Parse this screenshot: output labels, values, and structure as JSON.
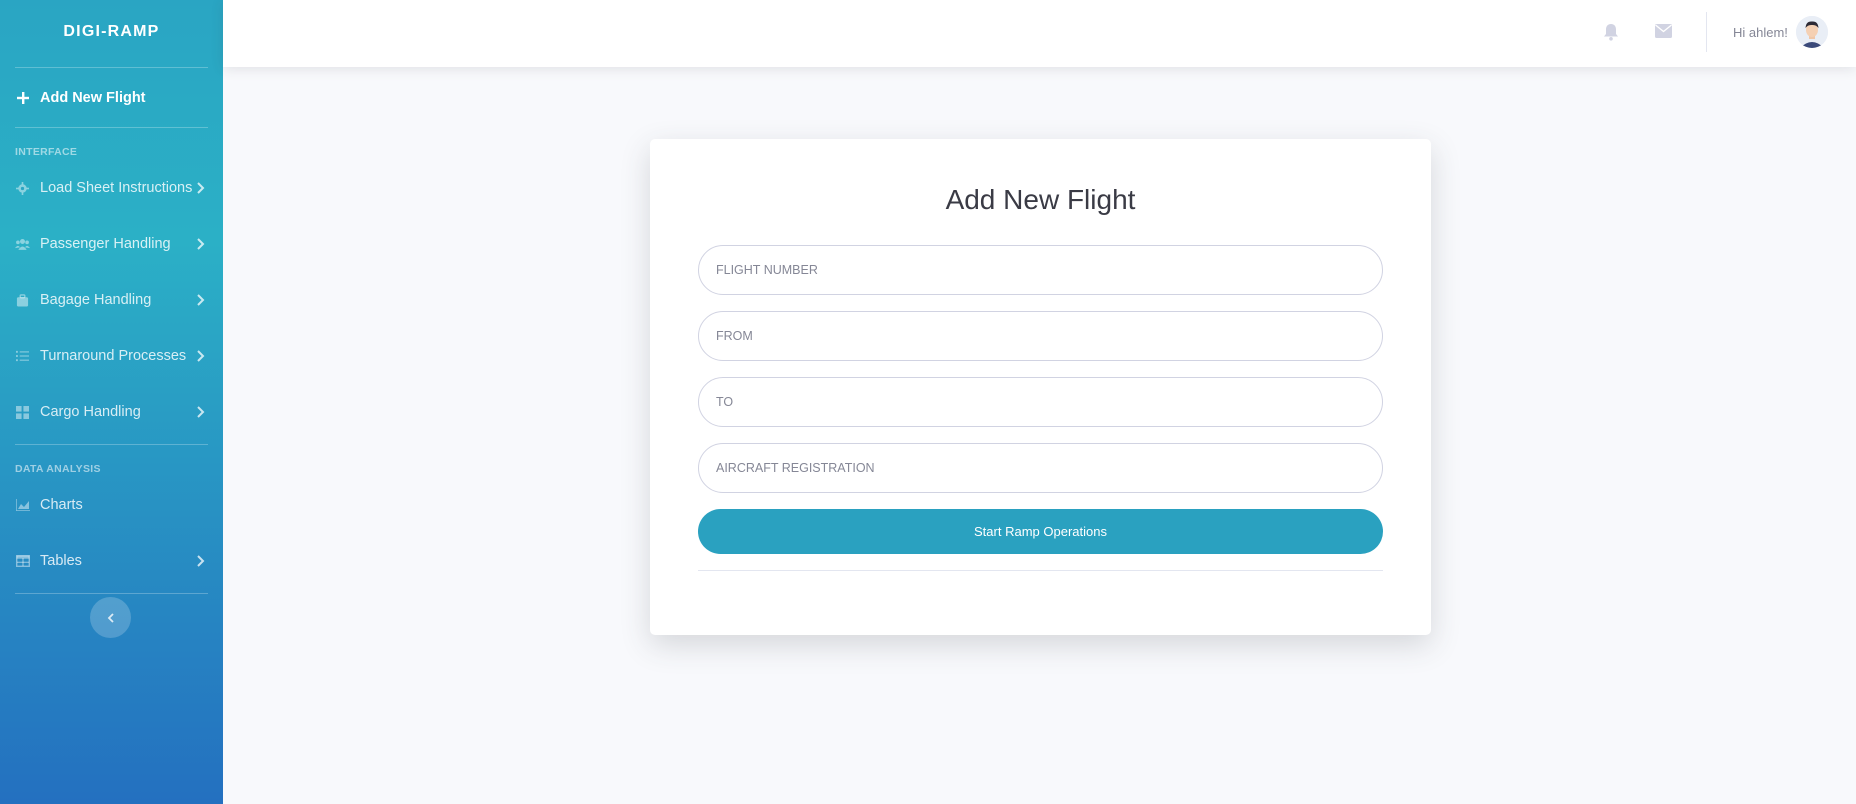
{
  "brand": "DIGI-RAMP",
  "sidebar": {
    "primary_action": {
      "label": "Add New Flight",
      "icon": "plus-icon"
    },
    "sections": [
      {
        "heading": "INTERFACE",
        "items": [
          {
            "label": "Load Sheet Instructions",
            "icon": "cog-icon",
            "has_chevron": true
          },
          {
            "label": "Passenger Handling",
            "icon": "users-icon",
            "has_chevron": true
          },
          {
            "label": "Bagage Handling",
            "icon": "suitcase-icon",
            "has_chevron": true
          },
          {
            "label": "Turnaround Processes",
            "icon": "list-icon",
            "has_chevron": true
          },
          {
            "label": "Cargo Handling",
            "icon": "grid-icon",
            "has_chevron": true
          }
        ]
      },
      {
        "heading": "DATA ANALYSIS",
        "items": [
          {
            "label": "Charts",
            "icon": "chart-area-icon",
            "has_chevron": false
          },
          {
            "label": "Tables",
            "icon": "table-icon",
            "has_chevron": true
          }
        ]
      }
    ],
    "toggle_icon": "chevron-left-icon"
  },
  "topbar": {
    "alerts_icon": "bell-icon",
    "messages_icon": "envelope-icon",
    "user_greeting": "Hi ahlem!",
    "avatar_icon": "user-avatar"
  },
  "form": {
    "title": "Add New Flight",
    "fields": [
      {
        "placeholder": "FLIGHT NUMBER",
        "value": ""
      },
      {
        "placeholder": "FROM",
        "value": ""
      },
      {
        "placeholder": "TO",
        "value": ""
      },
      {
        "placeholder": "AIRCRAFT REGISTRATION",
        "value": ""
      }
    ],
    "submit_label": "Start Ramp Operations"
  },
  "colors": {
    "sidebar_gradient_top": "#2aa5c3",
    "sidebar_gradient_bottom": "#2470c0",
    "primary_button": "#2aa1c0",
    "page_background": "#f8f9fc"
  }
}
